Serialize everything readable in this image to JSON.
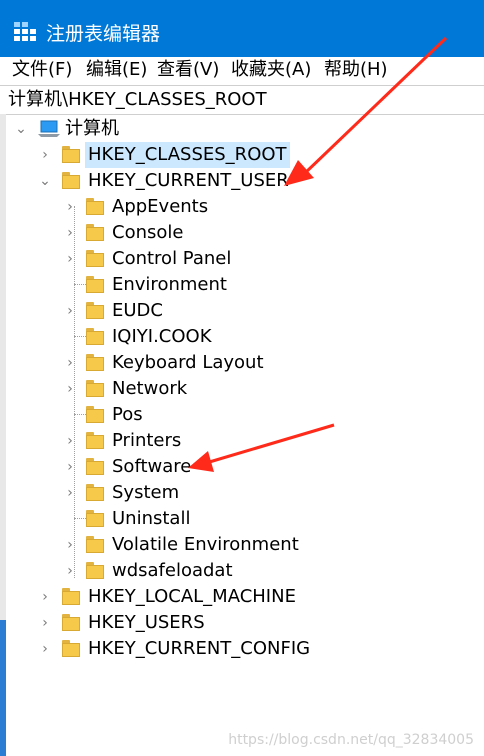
{
  "window": {
    "title": "注册表编辑器"
  },
  "menu": [
    {
      "label": "文件(F)"
    },
    {
      "label": "编辑(E)"
    },
    {
      "label": "查看(V)"
    },
    {
      "label": "收藏夹(A)"
    },
    {
      "label": "帮助(H)"
    }
  ],
  "address": "计算机\\HKEY_CLASSES_ROOT",
  "tree": {
    "root": "计算机",
    "hives": [
      {
        "label": "HKEY_CLASSES_ROOT"
      },
      {
        "label": "HKEY_CURRENT_USER"
      }
    ],
    "current_user_children": [
      {
        "label": "AppEvents"
      },
      {
        "label": "Console"
      },
      {
        "label": "Control Panel"
      },
      {
        "label": "Environment"
      },
      {
        "label": "EUDC"
      },
      {
        "label": "IQIYI.COOK"
      },
      {
        "label": "Keyboard Layout"
      },
      {
        "label": "Network"
      },
      {
        "label": "Pos"
      },
      {
        "label": "Printers"
      },
      {
        "label": "Software"
      },
      {
        "label": "System"
      },
      {
        "label": "Uninstall"
      },
      {
        "label": "Volatile Environment"
      },
      {
        "label": "wdsafeloadat"
      }
    ],
    "other_hives": [
      {
        "label": "HKEY_LOCAL_MACHINE"
      },
      {
        "label": "HKEY_USERS"
      },
      {
        "label": "HKEY_CURRENT_CONFIG"
      }
    ]
  },
  "watermark": "https://blog.csdn.net/qq_32834005",
  "colors": {
    "titlebar": "#0078d7",
    "selection": "#cce8ff",
    "folder": "#f7c94a",
    "arrow": "#ff2a1a"
  },
  "icons": {
    "expanded": "chevron-down-icon",
    "collapsed": "chevron-right-icon",
    "folder": "folder-icon",
    "computer": "computer-icon"
  }
}
